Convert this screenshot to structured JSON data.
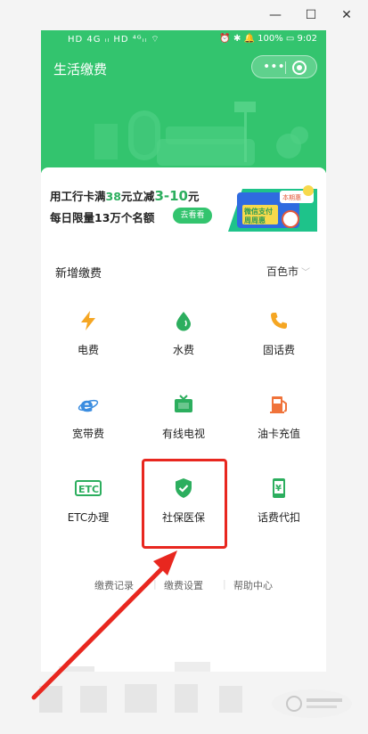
{
  "window": {
    "minimize_glyph": "—",
    "maximize_glyph": "☐",
    "close_glyph": "✕"
  },
  "statusbar": {
    "left": "HD 4G ᵢₗ HD ⁴ᴳᵢₗ ⌔",
    "right": "⏰ ✱ 🔔 100% ▭ 9:02"
  },
  "app": {
    "title": "生活缴费"
  },
  "banner": {
    "line1_a": "用工行卡满",
    "line1_b": "38",
    "line1_c": "元立减",
    "line1_d": "3-10",
    "line1_e": "元",
    "line2": "每日限量13万个名额",
    "cta": "去看看",
    "art_text_1": "微信支付",
    "art_text_2": "周周惠",
    "art_badge": "本期惠"
  },
  "section": {
    "title": "新增缴费",
    "city": "百色市"
  },
  "services": [
    {
      "label": "电费",
      "icon": "lightning-icon",
      "color": "#f5a623"
    },
    {
      "label": "水费",
      "icon": "water-drop-icon",
      "color": "#2cae5e"
    },
    {
      "label": "固话费",
      "icon": "phone-icon",
      "color": "#f5a623"
    },
    {
      "label": "宽带费",
      "icon": "ie-browser-icon",
      "color": "#3b8de0"
    },
    {
      "label": "有线电视",
      "icon": "tv-icon",
      "color": "#2cae5e"
    },
    {
      "label": "油卡充值",
      "icon": "gas-pump-icon",
      "color": "#f0733a"
    },
    {
      "label": "ETC办理",
      "icon": "etc-icon",
      "color": "#2cae5e"
    },
    {
      "label": "社保医保",
      "icon": "shield-check-icon",
      "color": "#2cae5e"
    },
    {
      "label": "话费代扣",
      "icon": "mobile-yuan-icon",
      "color": "#2cae5e"
    }
  ],
  "links": {
    "records": "缴费记录",
    "settings": "缴费设置",
    "help": "帮助中心"
  },
  "colors": {
    "brand_green": "#33c46e",
    "annotation_red": "#e8271f"
  }
}
